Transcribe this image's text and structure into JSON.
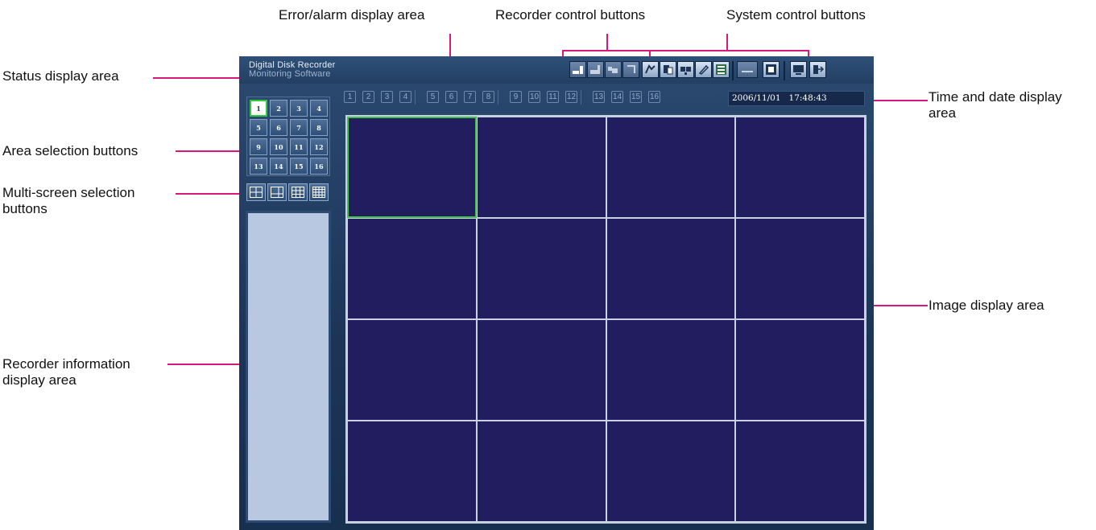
{
  "app": {
    "title_line1": "Digital Disk Recorder",
    "title_line2": "Monitoring Software"
  },
  "callouts": {
    "error_alarm": "Error/alarm display area",
    "recorder_control": "Recorder control buttons",
    "system_control": "System control buttons",
    "status_display": "Status display area",
    "time_date_1": "Time and date display",
    "time_date_2": "area",
    "area_selection": "Area selection buttons",
    "multi_screen_1": "Multi-screen selection",
    "multi_screen_2": "buttons",
    "image_display": "Image display area",
    "recorder_info_1": "Recorder information",
    "recorder_info_2": "display area"
  },
  "area_buttons": [
    "1",
    "2",
    "3",
    "4",
    "5",
    "6",
    "7",
    "8",
    "9",
    "10",
    "11",
    "12",
    "13",
    "14",
    "15",
    "16"
  ],
  "selected_area": 1,
  "status_channels": [
    "1",
    "2",
    "3",
    "4",
    "5",
    "6",
    "7",
    "8",
    "9",
    "10",
    "11",
    "12",
    "13",
    "14",
    "15",
    "16"
  ],
  "datetime": "2006/11/01   17:48:43",
  "multi_screen_options": [
    "quad-icon",
    "split-icon",
    "nine-grid-icon",
    "sixteen-grid-icon"
  ],
  "colors": {
    "callout_line": "#d6197a",
    "window_bg": "#1c3557",
    "image_bg": "#211d5e",
    "selected_border": "#3fc04b"
  }
}
